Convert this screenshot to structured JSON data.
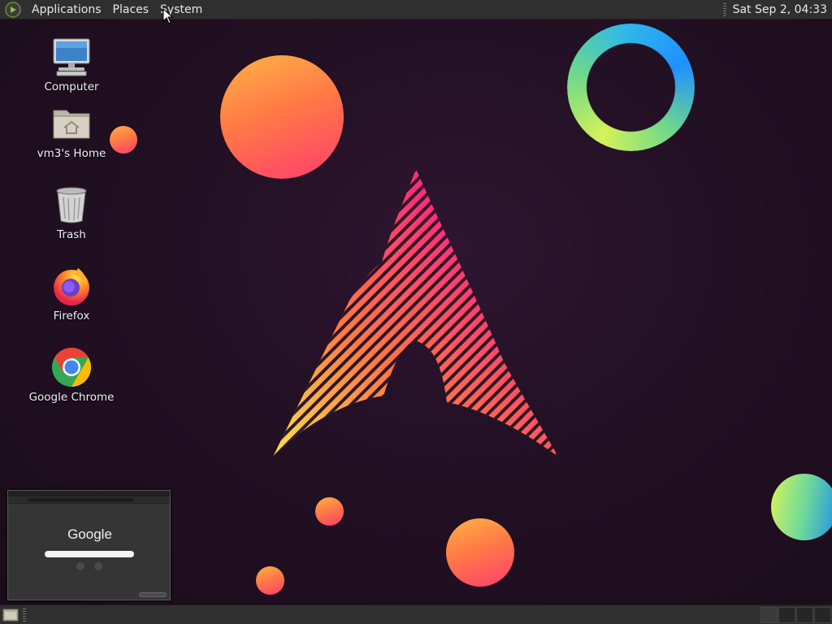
{
  "top_panel": {
    "menus": [
      "Applications",
      "Places",
      "System"
    ],
    "clock": "Sat Sep  2, 04:33"
  },
  "desktop_icons": [
    {
      "label": "Computer",
      "icon": "computer-icon"
    },
    {
      "label": "vm3's Home",
      "icon": "home-folder-icon"
    },
    {
      "label": "Trash",
      "icon": "trash-icon"
    },
    {
      "label": "Firefox",
      "icon": "firefox-icon"
    },
    {
      "label": "Google Chrome",
      "icon": "chrome-icon"
    }
  ],
  "window_preview": {
    "logo_text": "Google"
  },
  "bottom_panel": {
    "workspaces": 4,
    "active_workspace": 1
  },
  "colors": {
    "panel": "#2f2f2f",
    "background": "#221023",
    "accent_pink": "#ff2f7a",
    "accent_orange": "#ff8a3d"
  }
}
